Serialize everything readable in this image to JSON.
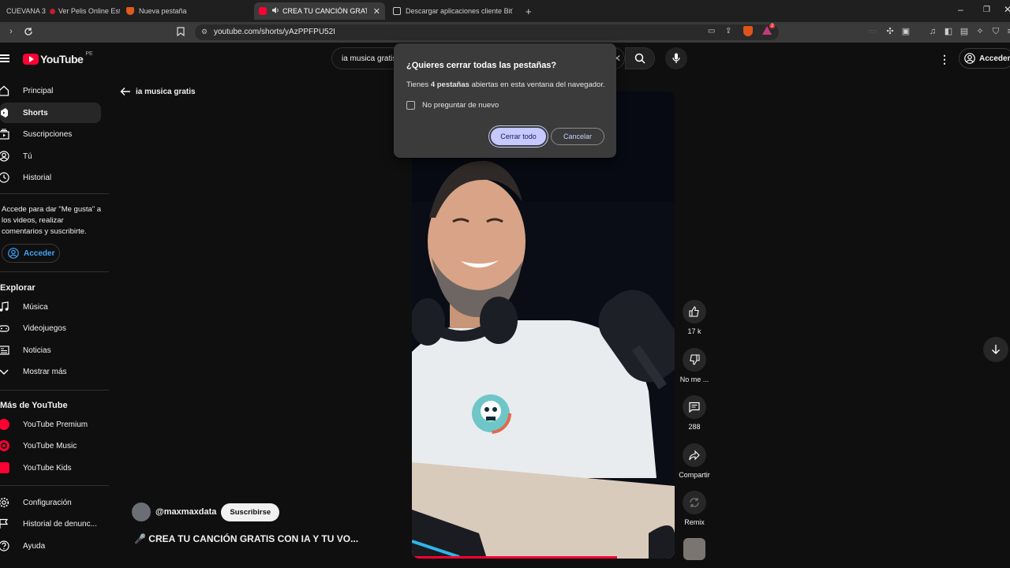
{
  "browser": {
    "tabs": [
      {
        "label": "CUEVANA 3"
      },
      {
        "label": "Ver Pelis Online Estr..."
      },
      {
        "label": "Nueva pestaña"
      },
      {
        "label": "CREA TU CANCIÓN GRAT..."
      },
      {
        "label": "Descargar aplicaciones cliente BitTor..."
      }
    ],
    "url": "youtube.com/shorts/yAzPPFPU52I",
    "brave_badge": "2"
  },
  "youtube": {
    "logo_text": "YouTube",
    "country": "PE",
    "search_value": "ia musica gratis",
    "signin_label": "Acceder",
    "sidebar": {
      "main": [
        {
          "label": "Principal"
        },
        {
          "label": "Shorts"
        },
        {
          "label": "Suscripciones"
        },
        {
          "label": "Tú"
        },
        {
          "label": "Historial"
        }
      ],
      "signin_prompt": "Accede para dar \"Me gusta\" a los videos, realizar comentarios y suscribirte.",
      "signin_button": "Acceder",
      "explore_title": "Explorar",
      "explore": [
        {
          "label": "Música"
        },
        {
          "label": "Videojuegos"
        },
        {
          "label": "Noticias"
        },
        {
          "label": "Mostrar más"
        }
      ],
      "more_title": "Más de YouTube",
      "more": [
        {
          "label": "YouTube Premium"
        },
        {
          "label": "YouTube Music"
        },
        {
          "label": "YouTube Kids"
        }
      ],
      "settings": [
        {
          "label": "Configuración"
        },
        {
          "label": "Historial de denunc..."
        },
        {
          "label": "Ayuda"
        }
      ]
    },
    "back_label": "ia musica gratis",
    "short": {
      "channel": "@maxmaxdata",
      "subscribe": "Suscribirse",
      "title": "🎤 CREA TU CANCIÓN GRATIS CON IA Y TU VO..."
    },
    "actions": {
      "like_count": "17 k",
      "dislike_label": "No me ...",
      "comments_count": "288",
      "share_label": "Compartir",
      "remix_label": "Remix"
    }
  },
  "dialog": {
    "title": "¿Quieres cerrar todas las pestañas?",
    "body_pre": "Tienes ",
    "body_bold": "4 pestañas",
    "body_post": " abiertas en esta ventana del navegador.",
    "checkbox_label": "No preguntar de nuevo",
    "confirm": "Cerrar todo",
    "cancel": "Cancelar"
  }
}
